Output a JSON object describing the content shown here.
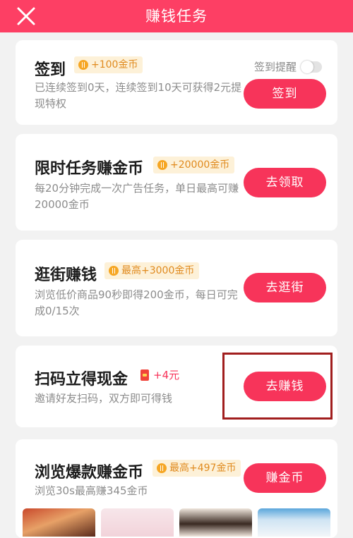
{
  "header": {
    "title": "赚钱任务",
    "close_icon": "close-icon"
  },
  "tasks": {
    "checkin": {
      "title": "签到",
      "reward": "+100金币",
      "remind_label": "签到提醒",
      "desc": "已连续签到0天，连续签到10天可获得2元提现特权",
      "button": "签到"
    },
    "limited": {
      "title": "限时任务赚金币",
      "reward": "+20000金币",
      "desc": "每20分钟完成一次广告任务，单日最高可赚20000金币",
      "button": "去领取"
    },
    "browse_shop": {
      "title": "逛街赚钱",
      "reward": "最高+3000金币",
      "desc": "浏览低价商品90秒即得200金币，每日可完成0/15次",
      "button": "去逛街"
    },
    "scan": {
      "title": "扫码立得现金",
      "reward": "+4元",
      "desc": "邀请好友扫码，双方即可得钱",
      "button": "去赚钱"
    },
    "hot_items": {
      "title": "浏览爆款赚金币",
      "reward": "最高+497金币",
      "desc": "浏览30s最高赚345金币",
      "button": "赚金币"
    }
  },
  "colors": {
    "brand": "#fd3f64",
    "button": "#f7345a",
    "badge_bg": "#fdf1d8",
    "badge_text": "#e08a1e",
    "highlight": "#a11e1e"
  }
}
